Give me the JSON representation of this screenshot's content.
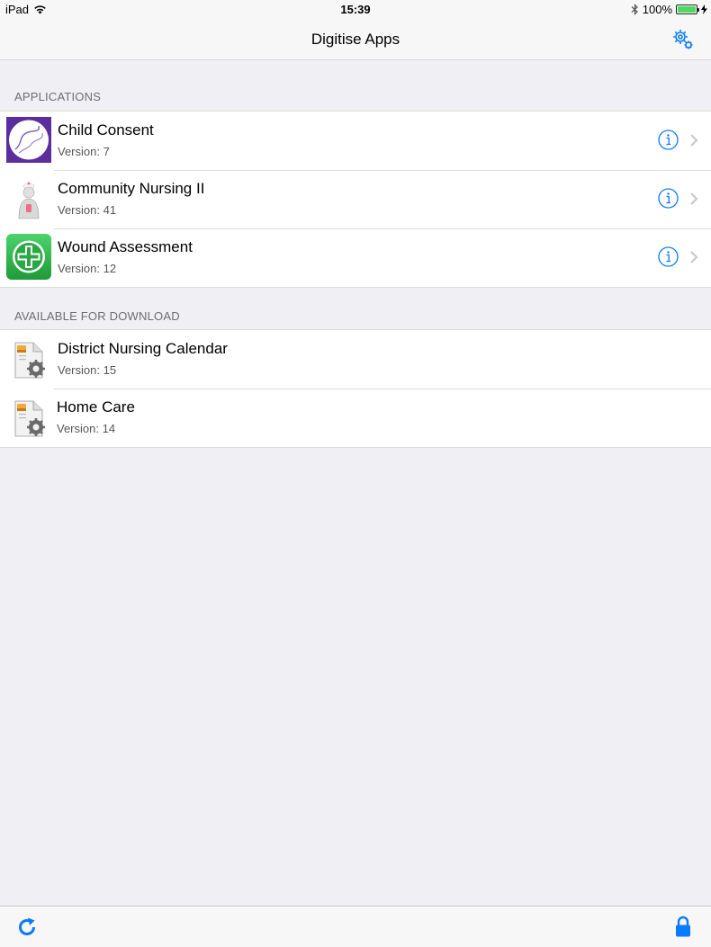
{
  "status_bar": {
    "device": "iPad",
    "time": "15:39",
    "battery_text": "100%",
    "battery_level": 1.0
  },
  "nav": {
    "title": "Digitise Apps",
    "settings_icon": "settings-gear-icon"
  },
  "sections": {
    "applications": {
      "header": "APPLICATIONS",
      "items": [
        {
          "title": "Child Consent",
          "version": "Version: 7",
          "icon": "child-consent-icon"
        },
        {
          "title": "Community Nursing II",
          "version": "Version: 41",
          "icon": "nurse-icon"
        },
        {
          "title": "Wound Assessment",
          "version": "Version: 12",
          "icon": "medical-cross-icon"
        }
      ]
    },
    "download": {
      "header": "AVAILABLE FOR DOWNLOAD",
      "items": [
        {
          "title": "District Nursing Calendar",
          "version": "Version: 15",
          "icon": "app-package-icon"
        },
        {
          "title": "Home Care",
          "version": "Version: 14",
          "icon": "app-package-icon"
        }
      ]
    }
  },
  "toolbar": {
    "refresh_icon": "refresh-icon",
    "lock_icon": "lock-icon"
  },
  "colors": {
    "accent": "#0a7aff",
    "background": "#efeff4",
    "battery": "#4cd964",
    "purple": "#5b2d9e",
    "green": "#2aa844"
  }
}
